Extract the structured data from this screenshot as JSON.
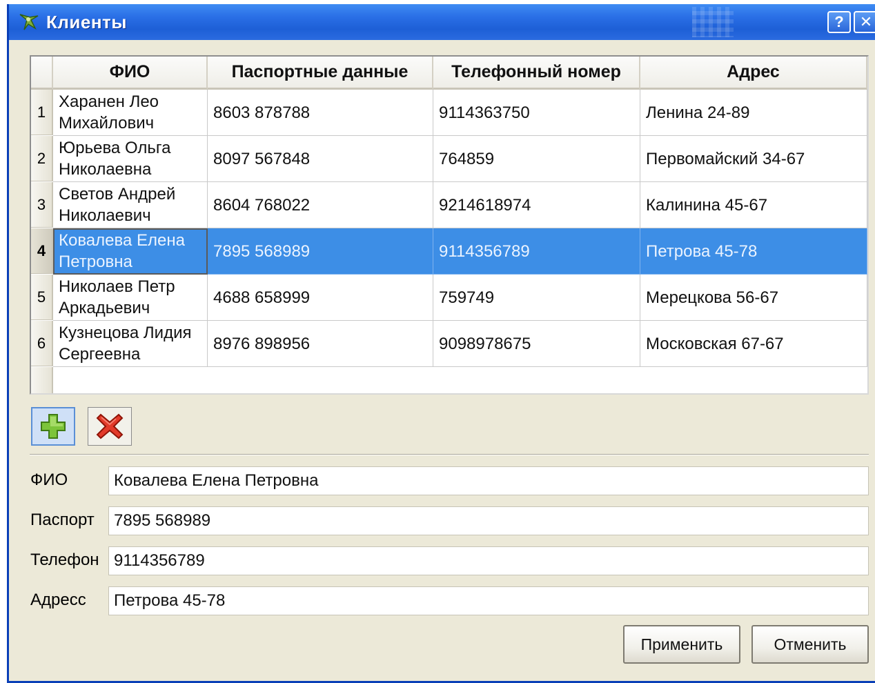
{
  "window": {
    "title": "Клиенты",
    "help_label": "?",
    "close_label": "✕"
  },
  "table": {
    "columns": [
      "ФИО",
      "Паспортные данные",
      "Телефонный номер",
      "Адрес"
    ],
    "rows": [
      {
        "num": "1",
        "fio": "Харанен Лео\nМихайлович",
        "passport": "8603 878788",
        "phone": "9114363750",
        "address": "Ленина 24-89"
      },
      {
        "num": "2",
        "fio": "Юрьева Ольга\nНиколаевна",
        "passport": "8097 567848",
        "phone": "764859",
        "address": "Первомайский 34-67"
      },
      {
        "num": "3",
        "fio": "Светов Андрей\nНиколаевич",
        "passport": "8604 768022",
        "phone": "9214618974",
        "address": "Калинина 45-67"
      },
      {
        "num": "4",
        "fio": "Ковалева Елена\nПетровна",
        "passport": "7895 568989",
        "phone": "9114356789",
        "address": "Петрова 45-78"
      },
      {
        "num": "5",
        "fio": "Николаев Петр\nАркадьевич",
        "passport": "4688 658999",
        "phone": "759749",
        "address": "Мерецкова 56-67"
      },
      {
        "num": "6",
        "fio": "Кузнецова Лидия\nСергеевна",
        "passport": "8976 898956",
        "phone": "9098978675",
        "address": "Московская 67-67"
      }
    ],
    "selected_row": "4"
  },
  "toolbar": {
    "add_icon": "plus-icon",
    "delete_icon": "red-x-icon"
  },
  "form": {
    "fio_label": "ФИО",
    "fio_value": "Ковалева Елена Петровна",
    "passport_label": "Паспорт",
    "passport_value": "7895 568989",
    "phone_label": "Телефон",
    "phone_value": "9114356789",
    "address_label": "Адресс",
    "address_value": "Петрова 45-78"
  },
  "buttons": {
    "apply": "Применить",
    "cancel": "Отменить"
  },
  "colors": {
    "titlebar": "#2a6fe6",
    "selection": "#3d8ee6",
    "window_bg": "#ece9d8"
  }
}
